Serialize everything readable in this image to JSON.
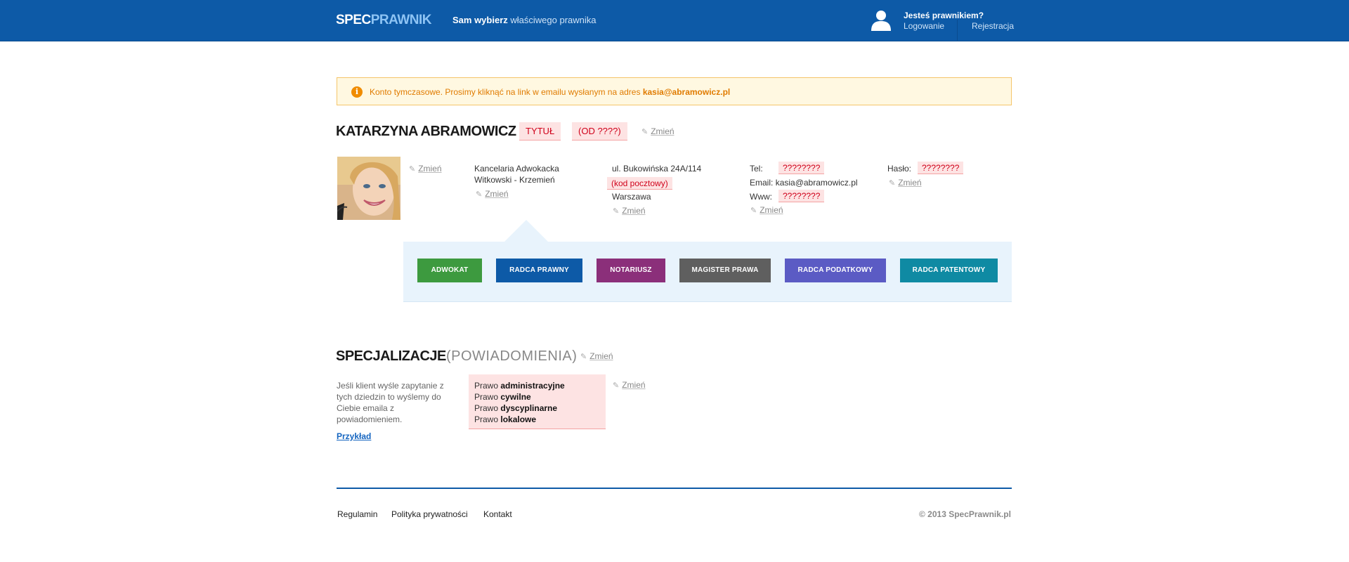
{
  "header": {
    "logo_spec": "SPEC",
    "logo_prawnik": "PRAWNIK",
    "tagline_bold": "Sam wybierz",
    "tagline_rest": " właściwego prawnika",
    "lawyer_question": "Jesteś prawnikiem?",
    "login": "Logowanie",
    "register": "Rejestracja",
    "icon": "user-icon"
  },
  "notice": {
    "icon": "info-icon",
    "text": "Konto tymczasowe. Prosimy kliknąć na link w emailu wysłanym na adres ",
    "email": "kasia@abramowicz.pl"
  },
  "profile": {
    "name": "KATARZYNA ABRAMOWICZ",
    "title_tag": "TYTUŁ",
    "since_tag": "(OD ????)",
    "edit_label": "Zmień",
    "firm_line1": "Kancelaria Adwokacka",
    "firm_line2": "Witkowski - Krzemień",
    "street": "ul. Bukowińska 24A/114",
    "postal_code": "(kod pocztowy)",
    "city": "Warszawa",
    "tel_label": "Tel:",
    "tel_value": "????????",
    "email_label": "Email:",
    "email_value": "kasia@abramowicz.pl",
    "www_label": "Www:",
    "www_value": "????????",
    "password_label": "Hasło:",
    "password_value": "????????"
  },
  "roles": [
    {
      "label": "ADWOKAT",
      "color": "#3d9a3f"
    },
    {
      "label": "RADCA PRAWNY",
      "color": "#0d5aa7"
    },
    {
      "label": "NOTARIUSZ",
      "color": "#8b2f7a"
    },
    {
      "label": "MAGISTER PRAWA",
      "color": "#5f5f5f"
    },
    {
      "label": "RADCA PODATKOWY",
      "color": "#5b5bc4"
    },
    {
      "label": "RADCA PATENTOWY",
      "color": "#0f8aa3"
    }
  ],
  "specializations": {
    "title": "SPECJALIZACJE",
    "subtitle": "(POWIADOMIENIA)",
    "edit_label": "Zmień",
    "description": "Jeśli klient wyśle zapytanie z tych dziedzin to wyślemy do Ciebie emaila z powiadomieniem.",
    "example_link": "Przykład",
    "items": [
      {
        "prefix": "Prawo ",
        "name": "administracyjne"
      },
      {
        "prefix": "Prawo ",
        "name": "cywilne"
      },
      {
        "prefix": "Prawo ",
        "name": "dyscyplinarne"
      },
      {
        "prefix": "Prawo ",
        "name": "lokalowe"
      }
    ]
  },
  "footer": {
    "links": [
      "Regulamin",
      "Polityka prywatności",
      "Kontakt"
    ],
    "copyright": "© 2013 SpecPrawnik.pl"
  },
  "colors": {
    "header_bg": "#0d5aa7",
    "notice_text": "#e07b00",
    "pink_tag_text": "#d0021b"
  }
}
